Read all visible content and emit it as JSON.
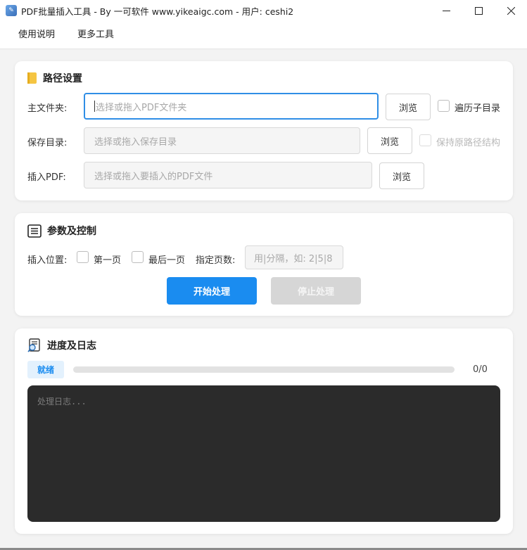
{
  "window": {
    "title": "PDF批量插入工具 - By 一可软件 www.yikeaigc.com - 用户: ceshi2",
    "icon": "app-logo-icon"
  },
  "menu": {
    "items": [
      {
        "label": "使用说明"
      },
      {
        "label": "更多工具"
      }
    ]
  },
  "path_settings": {
    "title": "路径设置",
    "icon": "folder-icon",
    "main_folder": {
      "label": "主文件夹:",
      "placeholder": "选择或拖入PDF文件夹",
      "browse_label": "浏览",
      "option_label": "遍历子目录"
    },
    "save_dir": {
      "label": "保存目录:",
      "placeholder": "选择或拖入保存目录",
      "browse_label": "浏览",
      "option_label": "保持原路径结构"
    },
    "insert_pdf": {
      "label": "插入PDF:",
      "placeholder": "选择或拖入要插入的PDF文件",
      "browse_label": "浏览"
    }
  },
  "params": {
    "title": "参数及控制",
    "icon": "list-icon",
    "position_label": "插入位置:",
    "first_page_label": "第一页",
    "last_page_label": "最后一页",
    "pages_label": "指定页数:",
    "pages_placeholder": "用|分隔，如: 2|5|8",
    "start_label": "开始处理",
    "stop_label": "停止处理"
  },
  "progress": {
    "title": "进度及日志",
    "icon": "log-search-icon",
    "status": "就绪",
    "value_fraction": 0,
    "count": "0/0",
    "log_placeholder": "处理日志..."
  },
  "colors": {
    "accent": "#1a8cf0",
    "focus_border": "#2f8ee6",
    "log_bg": "#2b2b2b"
  }
}
